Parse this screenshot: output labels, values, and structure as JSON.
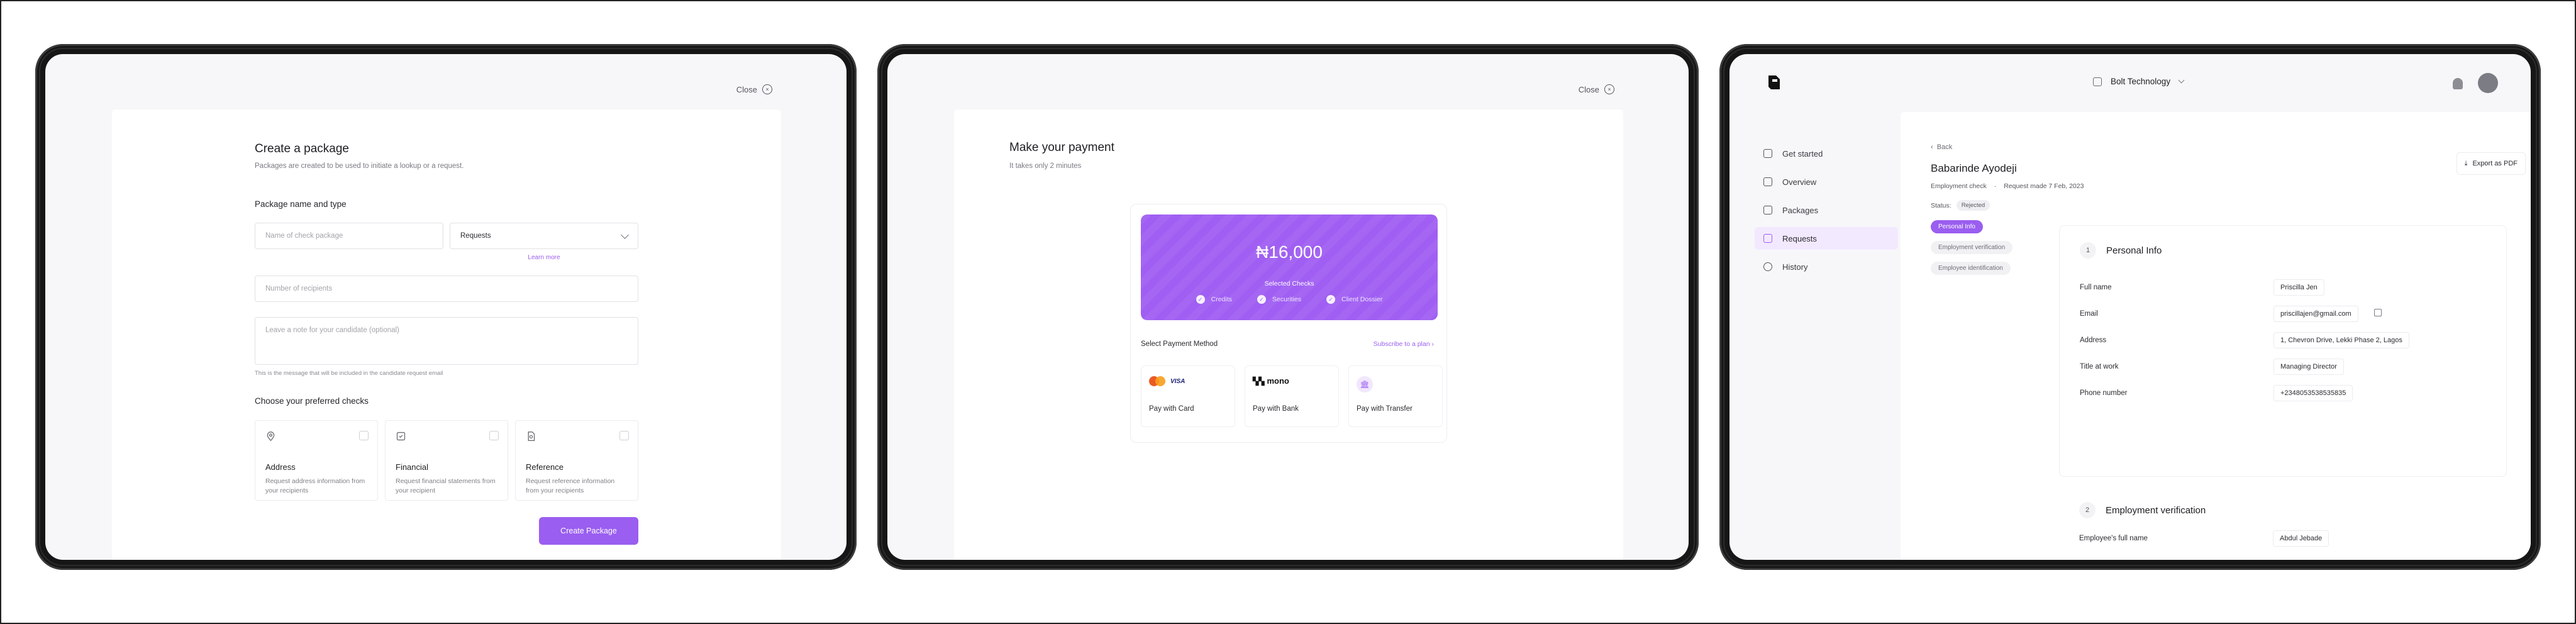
{
  "screen1": {
    "close": "Close",
    "title": "Create a package",
    "subtitle": "Packages are created to be used to initiate a lookup or a request.",
    "section_name_type": "Package name and type",
    "name_placeholder": "Name of check package",
    "type_value": "Requests",
    "learn_more": "Learn more",
    "recipients_placeholder": "Number of recipients",
    "note_placeholder": "Leave a note for your candidate (optional)",
    "note_hint": "This is the message that will be included in the candidate request email",
    "checks_label": "Choose your preferred checks",
    "checks": [
      {
        "title": "Address",
        "desc": "Request address information from your recipients"
      },
      {
        "title": "Financial",
        "desc": "Request financial statements from your recipient"
      },
      {
        "title": "Reference",
        "desc": "Request reference information from your recipients"
      }
    ],
    "create_button": "Create Package"
  },
  "screen2": {
    "close": "Close",
    "title": "Make your payment",
    "subtitle": "It takes only 2 minutes",
    "amount": "₦16,000",
    "selected_checks_label": "Selected Checks",
    "selected_checks": [
      "Credits",
      "Securities",
      "Client Dossier"
    ],
    "select_method_label": "Select Payment Method",
    "subscribe_link": "Subscribe to a plan",
    "methods": [
      {
        "label": "Pay with Card",
        "brand": "VISA"
      },
      {
        "label": "Pay with Bank",
        "brand": "mono"
      },
      {
        "label": "Pay with Transfer",
        "brand": ""
      }
    ]
  },
  "screen3": {
    "org_name": "Bolt Technology",
    "nav": [
      "Get started",
      "Overview",
      "Packages",
      "Requests",
      "History"
    ],
    "back": "Back",
    "person_name": "Babarinde Ayodeji",
    "check_type": "Employment check",
    "request_made": "Request made 7 Feb, 2023",
    "status_label": "Status:",
    "status_value": "Rejected",
    "export": "Export as PDF",
    "tabs": [
      "Personal Info",
      "Employment verification",
      "Employee identification"
    ],
    "section1_num": "1",
    "section1_title": "Personal Info",
    "fields": [
      {
        "label": "Full name",
        "value": "Priscilla Jen"
      },
      {
        "label": "Email",
        "value": "priscillajen@gmail.com"
      },
      {
        "label": "Address",
        "value": "1, Chevron Drive, Lekki Phase 2, Lagos"
      },
      {
        "label": "Title at work",
        "value": "Managing Director"
      },
      {
        "label": "Phone number",
        "value": "+2348053538535835"
      }
    ],
    "section2_num": "2",
    "section2_title": "Employment verification",
    "employee_name_label": "Employee's full name",
    "employee_name_value": "Abdul Jebade"
  },
  "colors": {
    "accent": "#9a5ef0",
    "banner": "#a05ff2",
    "nav_active": "#f3e9fe",
    "device_frame": "#161616"
  }
}
